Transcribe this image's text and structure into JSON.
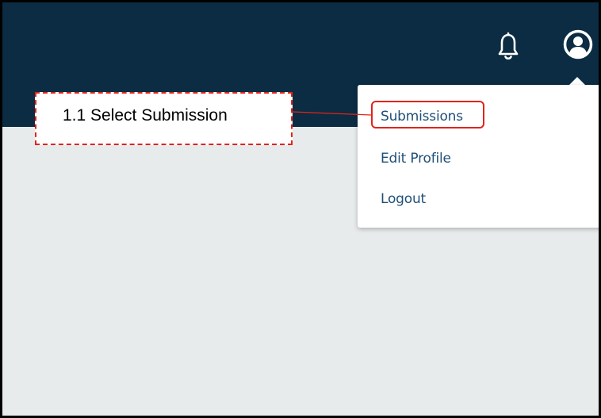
{
  "header": {
    "notifications_icon": "bell-icon",
    "account_icon": "user-circle-icon",
    "background_color": "#0c2c43"
  },
  "account_menu": {
    "items": [
      {
        "label": "Submissions",
        "highlighted": true
      },
      {
        "label": "Edit Profile"
      },
      {
        "label": "Logout"
      }
    ],
    "link_color": "#1f4f77"
  },
  "annotation": {
    "text": "1.1 Select Submission",
    "color": "#e0241c"
  },
  "page": {
    "background_color": "#e8ebec"
  }
}
